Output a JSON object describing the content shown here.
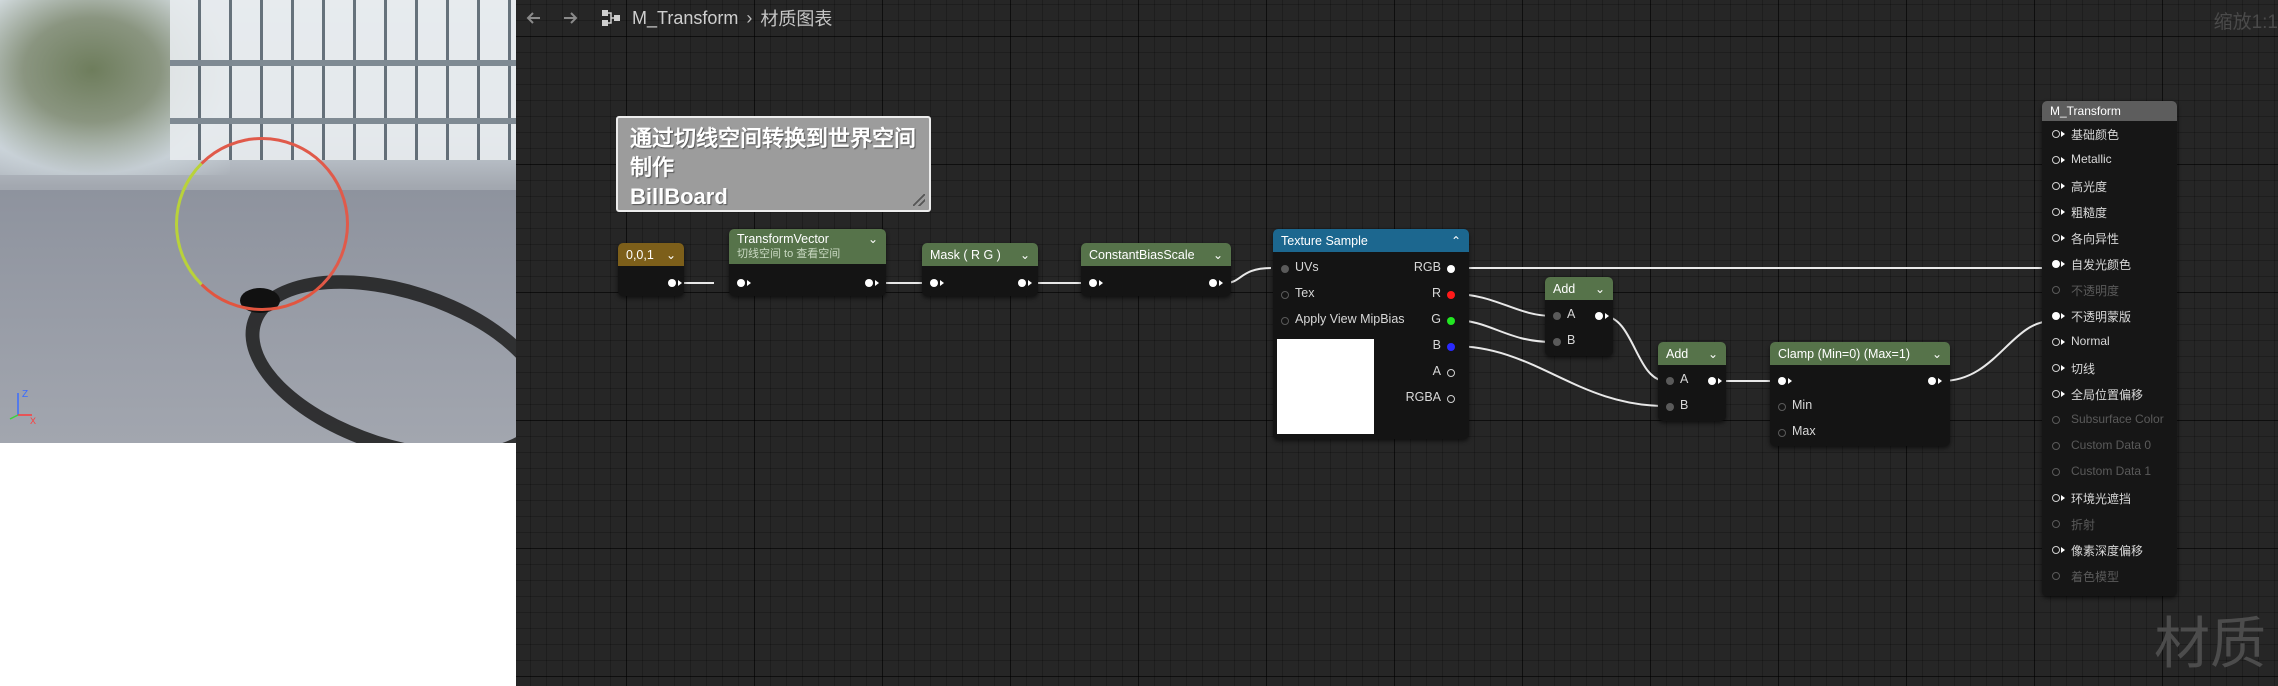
{
  "viewport": {
    "axis": {
      "z": "Z",
      "x": "X"
    }
  },
  "toolbar": {
    "back_icon": "arrow-left-icon",
    "forward_icon": "arrow-right-icon",
    "graph_icon": "material-graph-icon",
    "asset_name": "M_Transform",
    "separator": "›",
    "graph_name": "材质图表",
    "zoom": "缩放1:1"
  },
  "watermark": "材质",
  "comment": {
    "line1": "通过切线空间转换到世界空间制作",
    "line2": "BillBoard"
  },
  "nodes": {
    "constant": {
      "title": "0,0,1",
      "color": "#8c6a1c"
    },
    "transform": {
      "title": "TransformVector",
      "subtitle": "切线空间 to 查看空间",
      "color": "#5a7a4a"
    },
    "mask": {
      "title": "Mask ( R G )",
      "color": "#5a7a4a"
    },
    "bias": {
      "title": "ConstantBiasScale",
      "color": "#5a7a4a"
    },
    "texture": {
      "title": "Texture Sample",
      "color": "#1e6a92",
      "inputs": [
        "UVs",
        "Tex",
        "Apply View MipBias"
      ],
      "outputs": [
        "RGB",
        "R",
        "G",
        "B",
        "A",
        "RGBA"
      ]
    },
    "add1": {
      "title": "Add",
      "inputs": [
        "A",
        "B"
      ],
      "color": "#5a7a4a"
    },
    "add2": {
      "title": "Add",
      "inputs": [
        "A",
        "B"
      ],
      "color": "#5a7a4a"
    },
    "clamp": {
      "title": "Clamp (Min=0) (Max=1)",
      "inputs": [
        "Min",
        "Max"
      ],
      "color": "#5a7a4a"
    },
    "result": {
      "title": "M_Transform",
      "pins": [
        {
          "label": "基础颜色",
          "enabled": true
        },
        {
          "label": "Metallic",
          "enabled": true
        },
        {
          "label": "高光度",
          "enabled": true
        },
        {
          "label": "粗糙度",
          "enabled": true
        },
        {
          "label": "各向异性",
          "enabled": true
        },
        {
          "label": "自发光颜色",
          "enabled": true
        },
        {
          "label": "不透明度",
          "enabled": false
        },
        {
          "label": "不透明蒙版",
          "enabled": true
        },
        {
          "label": "Normal",
          "enabled": true
        },
        {
          "label": "切线",
          "enabled": true
        },
        {
          "label": "全局位置偏移",
          "enabled": true
        },
        {
          "label": "Subsurface Color",
          "enabled": false
        },
        {
          "label": "Custom Data 0",
          "enabled": false
        },
        {
          "label": "Custom Data 1",
          "enabled": false
        },
        {
          "label": "环境光遮挡",
          "enabled": true
        },
        {
          "label": "折射",
          "enabled": false
        },
        {
          "label": "像素深度偏移",
          "enabled": true
        },
        {
          "label": "着色模型",
          "enabled": false
        }
      ]
    }
  }
}
